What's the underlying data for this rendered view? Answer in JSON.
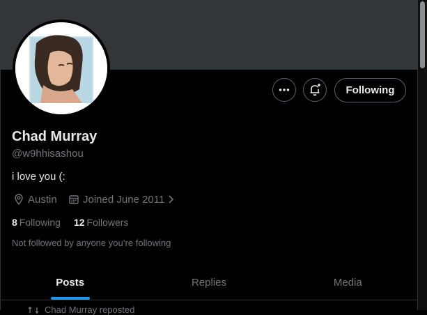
{
  "profile": {
    "name": "Chad Murray",
    "handle": "@w9hhisashou",
    "bio": "i love you (:",
    "location": "Austin",
    "joined": "Joined June 2011"
  },
  "stats": {
    "following_count": "8",
    "following_label": "Following",
    "followers_count": "12",
    "followers_label": "Followers"
  },
  "not_followed_text": "Not followed by anyone you’re following",
  "actions": {
    "follow_label": "Following",
    "more_icon": "more-horizontal-icon",
    "notify_icon": "bell-plus-icon"
  },
  "tabs": [
    {
      "label": "Posts",
      "active": true
    },
    {
      "label": "Replies",
      "active": false
    },
    {
      "label": "Media",
      "active": false
    }
  ],
  "next_item": {
    "text": "Chad Murray reposted",
    "icon": "repost-icon"
  },
  "colors": {
    "background": "#000000",
    "banner": "#333639",
    "accent": "#1d9bf0",
    "muted_text": "#71767b"
  }
}
